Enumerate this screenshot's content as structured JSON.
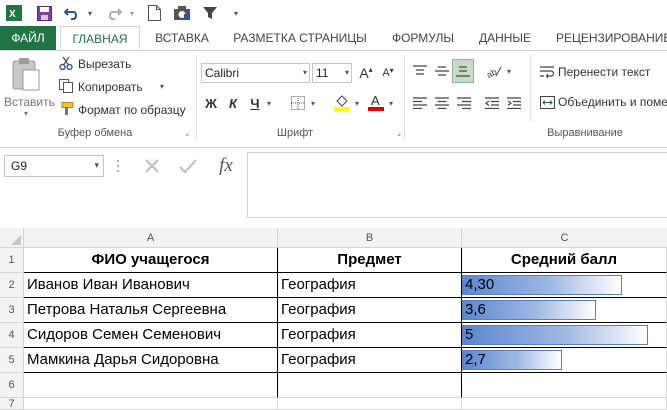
{
  "qat": {
    "icons": [
      "excel-logo-icon",
      "save-icon",
      "undo-icon",
      "redo-icon",
      "new-document-icon",
      "camera-icon",
      "filter-icon",
      "customize-icon"
    ]
  },
  "tabs": [
    {
      "label": "ФАЙЛ"
    },
    {
      "label": "ГЛАВНАЯ"
    },
    {
      "label": "ВСТАВКА"
    },
    {
      "label": "РАЗМЕТКА СТРАНИЦЫ"
    },
    {
      "label": "ФОРМУЛЫ"
    },
    {
      "label": "ДАННЫЕ"
    },
    {
      "label": "РЕЦЕНЗИРОВАНИЕ"
    }
  ],
  "clipboard": {
    "paste": "Вставить",
    "cut": "Вырезать",
    "copy": "Копировать",
    "format_painter": "Формат по образцу",
    "label": "Буфер обмена"
  },
  "font": {
    "name": "Calibri",
    "size": "11",
    "bold": "Ж",
    "italic": "К",
    "underline": "Ч",
    "label": "Шрифт"
  },
  "alignment": {
    "wrap": "Перенести текст",
    "merge": "Объединить и поме",
    "label": "Выравнивание"
  },
  "formula_bar": {
    "name_box": "G9",
    "fx": "fx",
    "content": ""
  },
  "sheet": {
    "columns": [
      "A",
      "B",
      "C"
    ],
    "rows": [
      "1",
      "2",
      "3",
      "4",
      "5",
      "6",
      "7"
    ],
    "headers": [
      "ФИО учащегося",
      "Предмет",
      "Средний балл"
    ],
    "data": [
      {
        "name": "Иванов Иван Иванович",
        "subject": "География",
        "score": "4,30",
        "fill": 0.86
      },
      {
        "name": "Петрова Наталья Сергеевна",
        "subject": "География",
        "score": "3,6",
        "fill": 0.72
      },
      {
        "name": "Сидоров Семен Семенович",
        "subject": "География",
        "score": "5",
        "fill": 1.0
      },
      {
        "name": "Мамкина Дарья Сидоровна",
        "subject": "География",
        "score": "2,7",
        "fill": 0.54
      }
    ]
  }
}
